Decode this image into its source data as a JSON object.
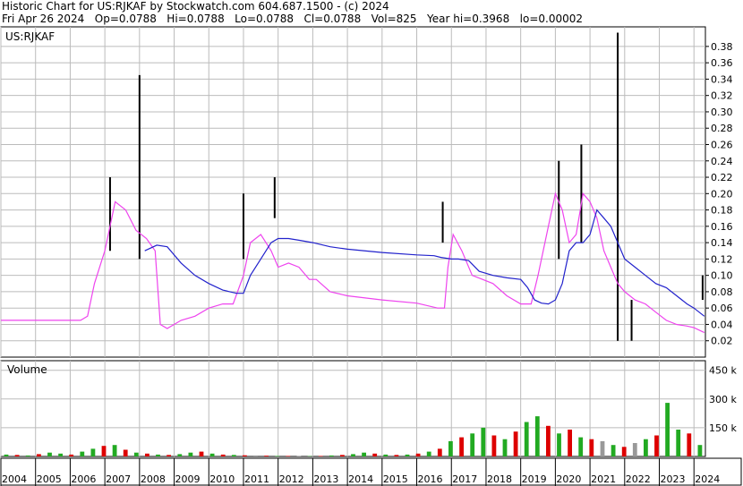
{
  "header": {
    "line1": "Historic Chart for US:RJKAF by Stockwatch.com 604.687.1500 - (c) 2024",
    "line2": "Fri Apr 26 2024   Op=0.0788   Hi=0.0788   Lo=0.0788   Cl=0.0788   Vol=825   Year hi=0.3968   lo=0.00002"
  },
  "colors": {
    "price_bar": "#000000",
    "close_dots": "#dd0000",
    "ma_short": "#ee44ee",
    "ma_long": "#2222cc",
    "volume_up": "#22aa22",
    "volume_down": "#dd0000",
    "volume_neutral": "#999999",
    "grid": "#bbbbbb"
  },
  "chart_data": [
    {
      "type": "line",
      "label": "US:RJKAF",
      "y_ticks": [
        "0.02",
        "0.04",
        "0.06",
        "0.08",
        "0.10",
        "0.12",
        "0.14",
        "0.16",
        "0.18",
        "0.20",
        "0.22",
        "0.24",
        "0.26",
        "0.28",
        "0.30",
        "0.32",
        "0.34",
        "0.36",
        "0.38"
      ],
      "ylim": [
        0.0,
        0.393
      ],
      "x_ticks": [
        "2004",
        "2005",
        "2006",
        "2007",
        "2008",
        "2009",
        "2010",
        "2011",
        "2012",
        "2013",
        "2014",
        "2015",
        "2016",
        "2017",
        "2018",
        "2019",
        "2020",
        "2021",
        "2022",
        "2023",
        "2024"
      ],
      "xlim": [
        2004.0,
        2024.33
      ],
      "series": [
        {
          "style": "ma_short",
          "x": [
            2004.0,
            2006.3,
            2006.5,
            2006.7,
            2007.0,
            2007.3,
            2007.6,
            2007.9,
            2008.2,
            2008.45,
            2008.6,
            2008.8,
            2009.2,
            2009.6,
            2010.0,
            2010.4,
            2010.7,
            2011.0,
            2011.2,
            2011.5,
            2011.8,
            2012.0,
            2012.3,
            2012.6,
            2012.9,
            2013.1,
            2013.5,
            2014.0,
            2015.0,
            2016.0,
            2016.6,
            2016.8,
            2016.9,
            2017.05,
            2017.3,
            2017.6,
            2017.9,
            2018.2,
            2018.6,
            2019.0,
            2019.3,
            2019.5,
            2019.8,
            2020.0,
            2020.2,
            2020.4,
            2020.6,
            2020.8,
            2021.0,
            2021.2,
            2021.4,
            2021.6,
            2021.8,
            2022.0,
            2022.3,
            2022.6,
            2022.9,
            2023.2,
            2023.5,
            2023.8,
            2024.0,
            2024.3
          ],
          "values": [
            0.045,
            0.045,
            0.05,
            0.09,
            0.13,
            0.19,
            0.18,
            0.155,
            0.145,
            0.13,
            0.04,
            0.035,
            0.045,
            0.05,
            0.06,
            0.065,
            0.065,
            0.1,
            0.14,
            0.15,
            0.13,
            0.11,
            0.115,
            0.11,
            0.095,
            0.095,
            0.08,
            0.075,
            0.07,
            0.066,
            0.06,
            0.06,
            0.11,
            0.15,
            0.13,
            0.1,
            0.095,
            0.09,
            0.075,
            0.065,
            0.065,
            0.1,
            0.16,
            0.2,
            0.18,
            0.14,
            0.15,
            0.2,
            0.19,
            0.17,
            0.13,
            0.11,
            0.09,
            0.08,
            0.07,
            0.065,
            0.055,
            0.045,
            0.04,
            0.038,
            0.036,
            0.03
          ]
        },
        {
          "style": "ma_long",
          "x": [
            2008.15,
            2008.5,
            2008.8,
            2009.2,
            2009.6,
            2010.0,
            2010.4,
            2010.6,
            2010.8,
            2011.0,
            2011.2,
            2011.5,
            2011.8,
            2012.0,
            2012.3,
            2012.6,
            2013.0,
            2013.5,
            2014.0,
            2015.0,
            2016.0,
            2016.5,
            2016.7,
            2017.0,
            2017.2,
            2017.5,
            2017.8,
            2018.2,
            2018.6,
            2019.0,
            2019.2,
            2019.4,
            2019.6,
            2019.8,
            2020.0,
            2020.2,
            2020.4,
            2020.6,
            2020.8,
            2021.0,
            2021.2,
            2021.4,
            2021.6,
            2021.8,
            2022.0,
            2022.3,
            2022.6,
            2022.9,
            2023.2,
            2023.5,
            2023.8,
            2024.0,
            2024.3
          ],
          "values": [
            0.13,
            0.137,
            0.135,
            0.115,
            0.1,
            0.09,
            0.082,
            0.08,
            0.078,
            0.078,
            0.1,
            0.12,
            0.14,
            0.145,
            0.145,
            0.143,
            0.14,
            0.135,
            0.132,
            0.128,
            0.125,
            0.124,
            0.122,
            0.12,
            0.12,
            0.118,
            0.105,
            0.1,
            0.097,
            0.095,
            0.085,
            0.07,
            0.066,
            0.065,
            0.07,
            0.09,
            0.13,
            0.14,
            0.14,
            0.15,
            0.18,
            0.17,
            0.16,
            0.14,
            0.12,
            0.11,
            0.1,
            0.09,
            0.085,
            0.075,
            0.065,
            0.06,
            0.05
          ]
        }
      ],
      "spikes": [
        {
          "x": 2008.0,
          "values": [
            0.12,
            0.345
          ]
        },
        {
          "x": 2007.15,
          "values": [
            0.13,
            0.22
          ]
        },
        {
          "x": 2011.0,
          "values": [
            0.12,
            0.2
          ]
        },
        {
          "x": 2011.9,
          "values": [
            0.17,
            0.22
          ]
        },
        {
          "x": 2016.75,
          "values": [
            0.14,
            0.19
          ]
        },
        {
          "x": 2020.1,
          "values": [
            0.12,
            0.24
          ]
        },
        {
          "x": 2020.75,
          "values": [
            0.14,
            0.26
          ]
        },
        {
          "x": 2021.8,
          "values": [
            0.02,
            0.3968
          ]
        },
        {
          "x": 2022.2,
          "values": [
            0.02,
            0.07
          ]
        },
        {
          "x": 2024.25,
          "values": [
            0.07,
            0.1
          ]
        }
      ]
    },
    {
      "type": "bar",
      "label": "Volume",
      "y_ticks": [
        "150 k",
        "300 k",
        "450 k"
      ],
      "ylim": [
        0,
        500
      ],
      "xlim": [
        2004.0,
        2024.33
      ],
      "values_k": [
        10,
        8,
        5,
        12,
        20,
        15,
        10,
        25,
        40,
        55,
        60,
        35,
        20,
        15,
        10,
        8,
        12,
        20,
        25,
        15,
        10,
        8,
        6,
        5,
        4,
        3,
        3,
        2,
        2,
        3,
        5,
        8,
        12,
        20,
        15,
        10,
        8,
        10,
        15,
        25,
        40,
        80,
        100,
        120,
        150,
        110,
        90,
        130,
        180,
        210,
        160,
        120,
        140,
        100,
        90,
        80,
        60,
        50,
        70,
        90,
        110,
        280,
        140,
        120,
        60
      ],
      "volume_colors": [
        "volume_up",
        "volume_down",
        "volume_up",
        "volume_down",
        "volume_up",
        "volume_up",
        "volume_down",
        "volume_up",
        "volume_up",
        "volume_down",
        "volume_up",
        "volume_down",
        "volume_up",
        "volume_down",
        "volume_up",
        "volume_down",
        "volume_up",
        "volume_up",
        "volume_down",
        "volume_up",
        "volume_down",
        "volume_up",
        "volume_down",
        "volume_neutral",
        "volume_down",
        "volume_up",
        "volume_down",
        "volume_neutral",
        "volume_up",
        "volume_down",
        "volume_up",
        "volume_down",
        "volume_up",
        "volume_up",
        "volume_down",
        "volume_up",
        "volume_down",
        "volume_up",
        "volume_down",
        "volume_up",
        "volume_down",
        "volume_up",
        "volume_down",
        "volume_up",
        "volume_up",
        "volume_down",
        "volume_up",
        "volume_down",
        "volume_up",
        "volume_up",
        "volume_down",
        "volume_up",
        "volume_down",
        "volume_up",
        "volume_down",
        "volume_neutral",
        "volume_up",
        "volume_down",
        "volume_neutral",
        "volume_up",
        "volume_down",
        "volume_up",
        "volume_up",
        "volume_down",
        "volume_up"
      ]
    }
  ]
}
